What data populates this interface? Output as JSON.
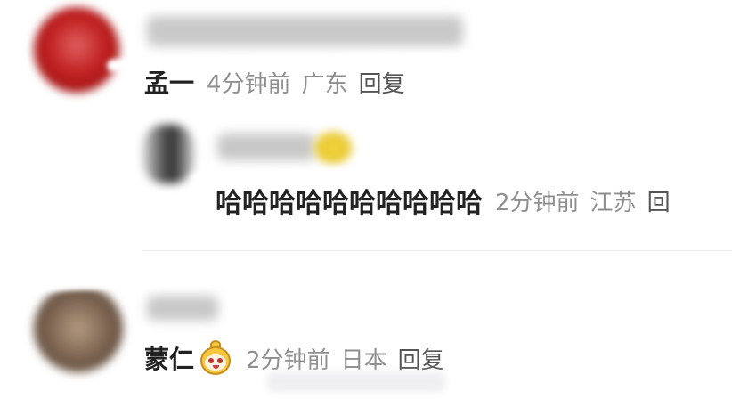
{
  "comments": [
    {
      "name": "孟一",
      "time": "4分钟前",
      "location": "广东",
      "reply_label": "回复"
    },
    {
      "text": "哈哈哈哈哈哈哈哈哈哈",
      "time": "2分钟前",
      "location": "江苏",
      "reply_label": "回"
    },
    {
      "name": "蒙仁",
      "sticker": "lemon-face-emoji-icon",
      "time": "2分钟前",
      "location": "日本",
      "reply_label": "回复"
    }
  ]
}
